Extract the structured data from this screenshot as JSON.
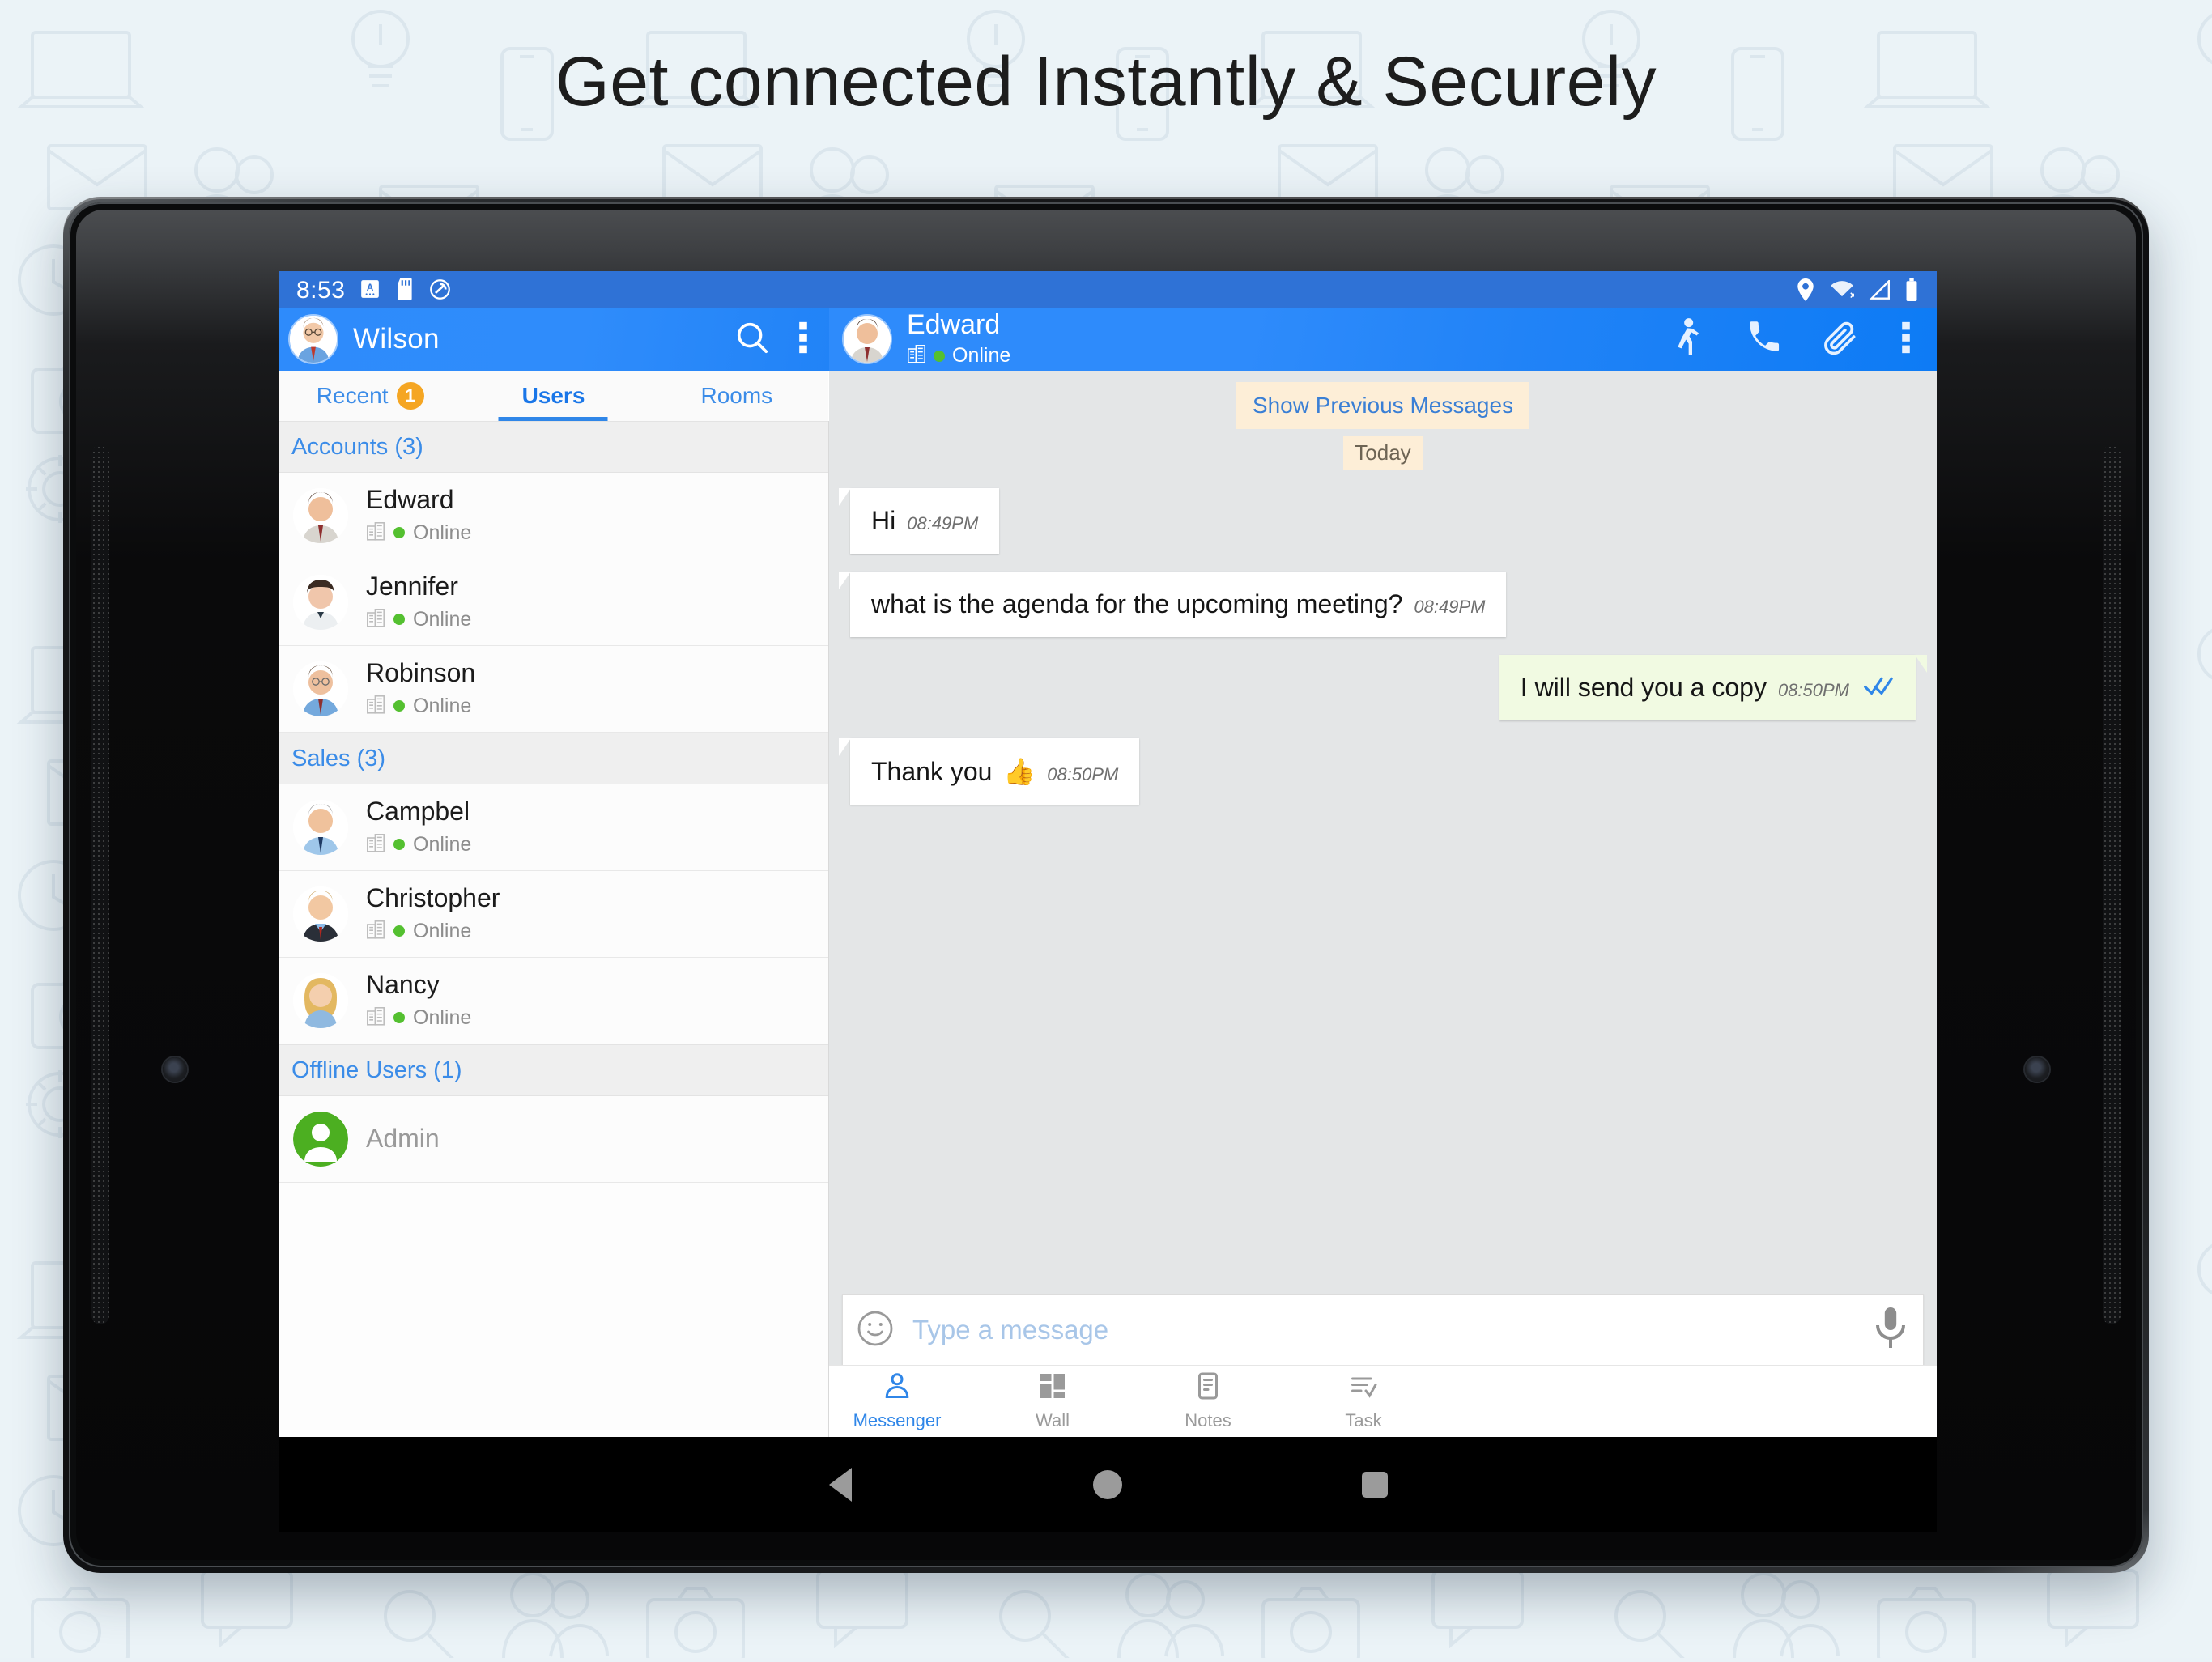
{
  "headline": "Get connected Instantly & Securely",
  "colors": {
    "page_bg": "#eaf2f7",
    "statusbar": "#2f72d6",
    "toolbar": "#2e8bfb",
    "accent": "#2f86e8",
    "badge": "#f5a623",
    "online": "#54c030",
    "outgoing_bubble": "#f1fae2",
    "incoming_bubble": "#ffffff",
    "chat_bg": "#e4e6e7",
    "notice_bg": "#fdeed7"
  },
  "statusbar": {
    "time": "8:53",
    "left_icons": [
      "keyboard-language-icon",
      "sd-card-icon",
      "sync-disabled-icon"
    ],
    "right_icons": [
      "location-icon",
      "wifi-off-icon",
      "signal-icon",
      "battery-icon"
    ]
  },
  "left_pane": {
    "toolbar": {
      "avatar": "wilson-avatar",
      "title": "Wilson",
      "actions": [
        "search-icon",
        "overflow-menu-icon"
      ]
    },
    "tabs": [
      {
        "label": "Recent",
        "badge": "1",
        "active": false
      },
      {
        "label": "Users",
        "badge": "",
        "active": true
      },
      {
        "label": "Rooms",
        "badge": "",
        "active": false
      }
    ],
    "groups": [
      {
        "header": "Accounts (3)",
        "contacts": [
          {
            "name": "Edward",
            "status": "Online",
            "offline": false
          },
          {
            "name": "Jennifer",
            "status": "Online",
            "offline": false
          },
          {
            "name": "Robinson",
            "status": "Online",
            "offline": false
          }
        ]
      },
      {
        "header": "Sales (3)",
        "contacts": [
          {
            "name": "Campbel",
            "status": "Online",
            "offline": false
          },
          {
            "name": "Christopher",
            "status": "Online",
            "offline": false
          },
          {
            "name": "Nancy",
            "status": "Online",
            "offline": false
          }
        ]
      },
      {
        "header": "Offline Users (1)",
        "contacts": [
          {
            "name": "Admin",
            "status": "",
            "offline": true
          }
        ]
      }
    ]
  },
  "right_pane": {
    "toolbar": {
      "avatar": "edward-avatar",
      "name": "Edward",
      "status": "Online",
      "actions": [
        "presence-walking-icon",
        "call-icon",
        "attachment-icon",
        "overflow-menu-icon"
      ]
    },
    "show_previous": "Show Previous Messages",
    "day_divider": "Today",
    "messages": [
      {
        "dir": "in",
        "text": "Hi",
        "time": "08:49PM",
        "emoji": "",
        "ticks": false
      },
      {
        "dir": "in",
        "text": "what is the agenda for the upcoming meeting?",
        "time": "08:49PM",
        "emoji": "",
        "ticks": false
      },
      {
        "dir": "out",
        "text": "I will send you a copy",
        "time": "08:50PM",
        "emoji": "",
        "ticks": true
      },
      {
        "dir": "in",
        "text": "Thank you",
        "time": "08:50PM",
        "emoji": "👍",
        "ticks": false
      }
    ],
    "composer": {
      "placeholder": "Type a message",
      "value": "",
      "left_icon": "emoji-icon",
      "right_icon": "microphone-icon"
    },
    "bottom_nav": [
      {
        "label": "Messenger",
        "icon": "person-icon",
        "active": true
      },
      {
        "label": "Wall",
        "icon": "dashboard-icon",
        "active": false
      },
      {
        "label": "Notes",
        "icon": "notes-icon",
        "active": false
      },
      {
        "label": "Task",
        "icon": "task-check-icon",
        "active": false
      }
    ]
  },
  "android_nav": {
    "back": "back-triangle-icon",
    "home": "home-circle-icon",
    "recents": "recents-square-icon"
  }
}
